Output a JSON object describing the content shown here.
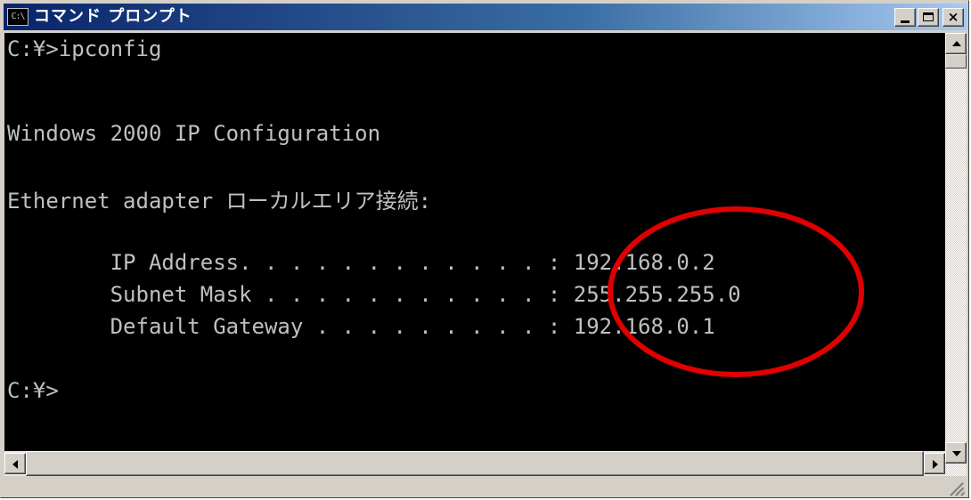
{
  "window": {
    "title": "コマンド プロンプト",
    "icon_text": "C:\\",
    "close_glyph": "×"
  },
  "console": {
    "lines": [
      "C:¥>ipconfig",
      "",
      "Windows 2000 IP Configuration",
      "",
      "Ethernet adapter ローカルエリア接続:",
      "",
      "        IP Address. . . . . . . . . . . . : 192.168.0.2",
      "        Subnet Mask . . . . . . . . . . . : 255.255.255.0",
      "        Default Gateway . . . . . . . . . : 192.168.0.1",
      "",
      "C:¥>"
    ]
  },
  "colors": {
    "titlebar_start": "#0a246a",
    "titlebar_end": "#a6caf0",
    "console_bg": "#000000",
    "console_fg": "#c0c0c0",
    "annotation_circle": "#e00000"
  }
}
